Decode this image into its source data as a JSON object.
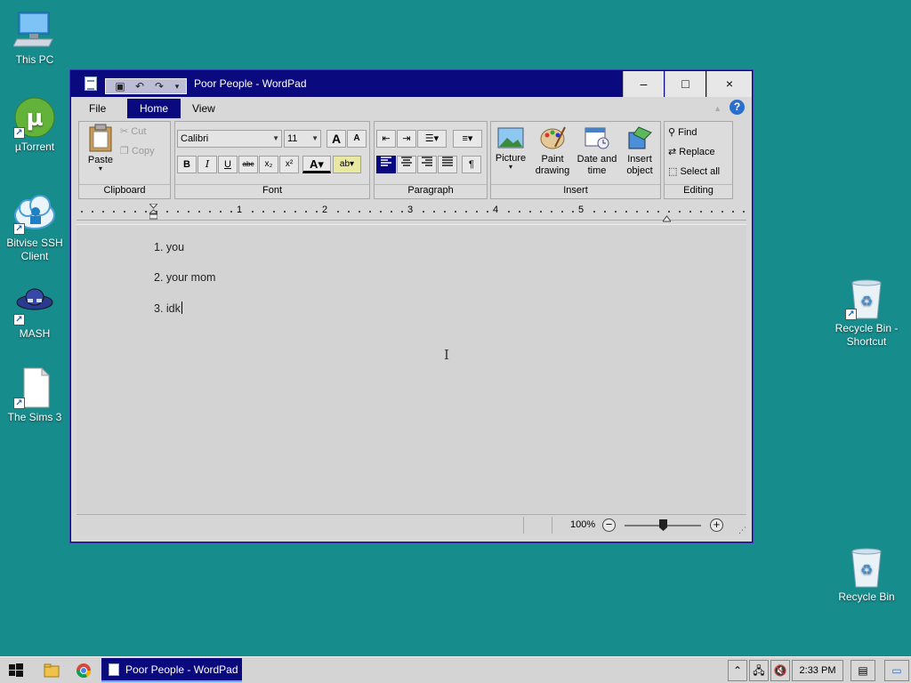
{
  "desktop": {
    "icons": [
      {
        "label": "This PC"
      },
      {
        "label": "µTorrent"
      },
      {
        "label": "Bitvise SSH Client"
      },
      {
        "label": "MASH"
      },
      {
        "label": "The Sims 3"
      },
      {
        "label": "Recycle Bin - Shortcut"
      },
      {
        "label": "Recycle Bin"
      }
    ]
  },
  "window": {
    "title": "Poor People - WordPad",
    "controls": {
      "minimize": "–",
      "maximize": "□",
      "close": "×"
    },
    "tabs": [
      {
        "label": "File"
      },
      {
        "label": "Home"
      },
      {
        "label": "View"
      }
    ],
    "active_tab": "Home",
    "help": "?",
    "ribbon": {
      "clipboard": {
        "label": "Clipboard",
        "paste": "Paste",
        "cut": "Cut",
        "copy": "Copy"
      },
      "font": {
        "label": "Font",
        "family": "Calibri",
        "size": "11"
      },
      "paragraph": {
        "label": "Paragraph"
      },
      "insert": {
        "label": "Insert",
        "picture": "Picture",
        "paint": "Paint drawing",
        "datetime": "Date and time",
        "object": "Insert object"
      },
      "editing": {
        "label": "Editing",
        "find": "Find",
        "replace": "Replace",
        "select_all": "Select all"
      }
    },
    "ruler_numbers": [
      "1",
      "2",
      "3",
      "4",
      "5"
    ],
    "document": {
      "lines": [
        "1. you",
        "2. your mom",
        "3. idk"
      ]
    },
    "status": {
      "zoom": "100%",
      "zoom_level_percent": 100
    }
  },
  "taskbar": {
    "task_label": "Poor People - WordPad",
    "clock": "2:33 PM"
  },
  "colors": {
    "desktop": "#178c8c",
    "titlebar": "#0a0a7e",
    "window": "#d8d8d8"
  }
}
